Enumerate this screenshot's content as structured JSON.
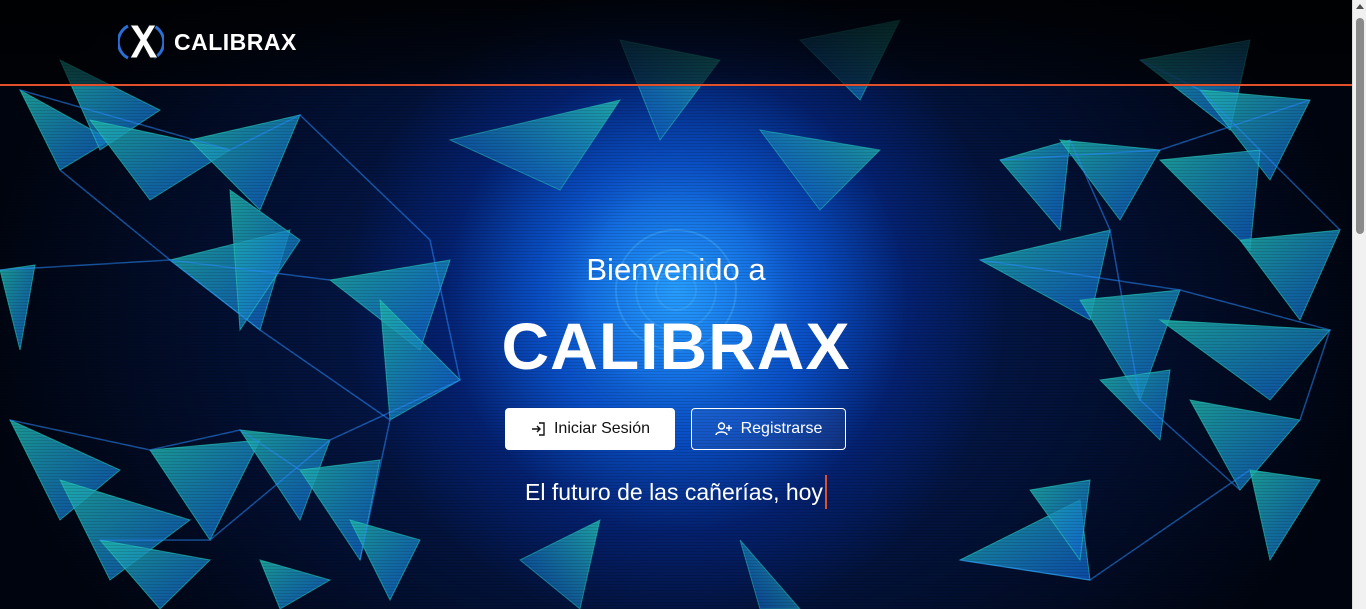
{
  "header": {
    "brand_name": "CALIBRAX",
    "logo_icon": "x-logo-icon",
    "accent_color": "#e1502a"
  },
  "hero": {
    "welcome": "Bienvenido a",
    "title": "CALIBRAX",
    "login_label": "Iniciar Sesión",
    "login_icon": "login-icon",
    "register_label": "Registrarse",
    "register_icon": "user-plus-icon",
    "tagline": "El futuro de las cañerías, hoy"
  }
}
